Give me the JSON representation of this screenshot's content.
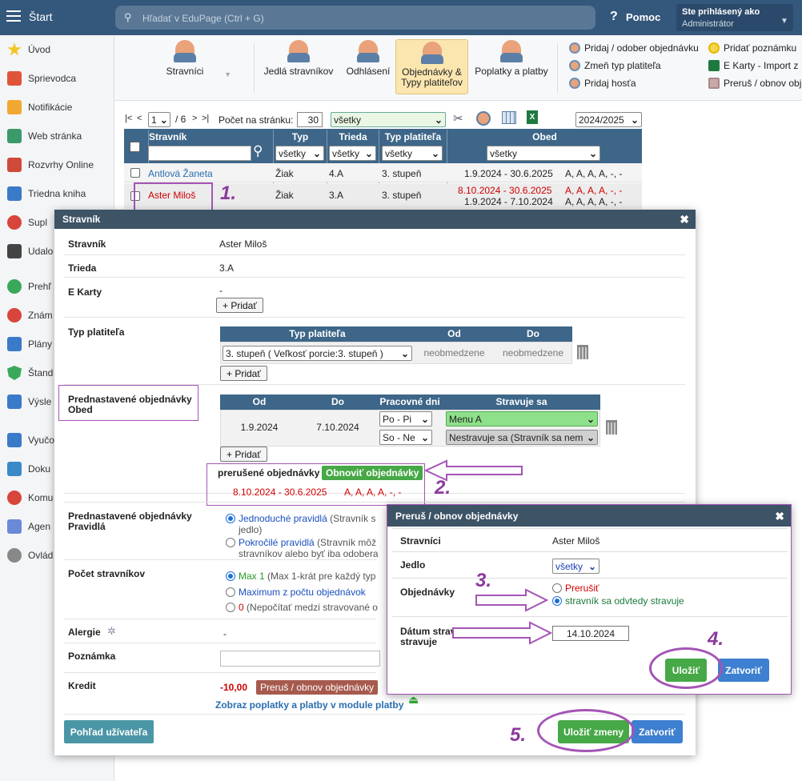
{
  "topbar": {
    "start": "Štart",
    "search_placeholder": "Hľadať v EduPage (Ctrl + G)",
    "help": "Pomoc",
    "logged_label": "Ste prihlásený ako",
    "logged_user": "Administrátor"
  },
  "sidebar": {
    "items": [
      "Úvod",
      "Sprievodca",
      "Notifikácie",
      "Web stránka",
      "Rozvrhy Online",
      "Triedna kniha",
      "Supl",
      "Udalo",
      "Prehľ",
      "Znám",
      "Plány",
      "Štand",
      "Výsle",
      "Vyučo",
      "Doku",
      "Komu",
      "Agen",
      "Ovlád"
    ]
  },
  "toolbar": {
    "stravnici": "Stravníci",
    "jedla": "Jedlá stravníkov",
    "odhlasenie": "Odhlásení",
    "objednavky": "Objednávky & Typy platiteľov",
    "poplatky": "Poplatky a platby",
    "links": [
      "Pridaj / odober objednávku",
      "Zmeň typ platiteľa",
      "Pridaj hosťa",
      "Pridať poznámku",
      "E Karty - Import z",
      "Preruš / obnov obj"
    ]
  },
  "pager": {
    "first": "|<",
    "prev": "<",
    "page": "1",
    "total": "/ 6",
    "next": ">",
    "last": ">|",
    "per_page_label": "Počet na stránku:",
    "per_page": "30",
    "filter": "všetky",
    "year": "2024/2025"
  },
  "table": {
    "headers": [
      "Stravník",
      "Typ",
      "Trieda",
      "Typ platiteľa",
      "Obed"
    ],
    "filter_all": "všetky",
    "rows": [
      {
        "name": "Antlová Žaneta",
        "typ": "Žiak",
        "trieda": "4.A",
        "platitel": "3. stupeň",
        "dates": [
          "1.9.2024 - 30.6.2025"
        ],
        "menu": [
          "A, A, A, A, -, -"
        ]
      },
      {
        "name": "Aster Miloš",
        "typ": "Žiak",
        "trieda": "3.A",
        "platitel": "3. stupeň",
        "dates": [
          "8.10.2024 - 30.6.2025",
          "1.9.2024 - 7.10.2024"
        ],
        "menu": [
          "A, A, A, A, -, -",
          "A, A, A, A, -, -"
        ]
      }
    ]
  },
  "dialog": {
    "title": "Stravník",
    "stravnik_label": "Stravník",
    "stravnik_value": "Aster Miloš",
    "trieda_label": "Trieda",
    "trieda_value": "3.A",
    "ekarty_label": "E Karty",
    "ekarty_value": "-",
    "add": "+ Pridať",
    "typ_label": "Typ platiteľa",
    "typ_headers": [
      "Typ platiteľa",
      "Od",
      "Do"
    ],
    "typ_value": "3. stupeň ( Veľkosť porcie:3. stupeň )",
    "typ_od": "neobmedzene",
    "typ_do": "neobmedzene",
    "pred_label": "Prednastavené objednávky Obed",
    "pred_headers": [
      "Od",
      "Do",
      "Pracovné dni",
      "Stravuje sa"
    ],
    "pred_od": "1.9.2024",
    "pred_do": "7.10.2024",
    "pred_days": [
      "Po - Pi",
      "So - Ne"
    ],
    "pred_menu": [
      "Menu A",
      "Nestravuje sa (Stravník sa nem"
    ],
    "prerusene": "prerušené objednávky",
    "obnovit": "Obnoviť objednávky",
    "prerusene_dates": "8.10.2024 - 30.6.2025",
    "prerusene_menu": "A, A, A, A, -, -",
    "pravidla_label": "Prednastavené objednávky Pravidlá",
    "pravidla_1_link": "Jednoduché pravidlá",
    "pravidla_1_text": "(Stravník s",
    "pravidla_1_text2": "jedlo)",
    "pravidla_2_link": "Pokročilé pravidlá",
    "pravidla_2_text": "(Stravník môž",
    "pravidla_2_text2": "stravníkov alebo byť iba odobera",
    "pocet_label": "Počet stravníkov",
    "pocet_1_link": "Max 1",
    "pocet_1_text": "(Max 1-krát pre každý typ",
    "pocet_2_link": "Maximum z počtu objednávok",
    "pocet_3_link": "0",
    "pocet_3_text": "(Nepočítať medzi stravované o",
    "alergie_label": "Alergie",
    "alergie_value": "-",
    "poznamka_label": "Poznámka",
    "kredit_label": "Kredit",
    "kredit_value": "-10,00",
    "prerus_btn": "Preruš / obnov objednávky",
    "poplatky_link": "Zobraz poplatky a platby v module platby",
    "pohlad": "Pohľad užívateľa",
    "ulozit": "Uložiť zmeny",
    "zatvorit": "Zatvoriť"
  },
  "dialog2": {
    "title": "Preruš / obnov objednávky",
    "stravnici_label": "Stravníci",
    "stravnici_value": "Aster Miloš",
    "jedlo_label": "Jedlo",
    "jedlo_value": "všetky",
    "obj_label": "Objednávky",
    "opt1": "Prerušiť",
    "opt2": "stravník sa odvtedy stravuje",
    "datum_label": "Dátum stravník sa odvtedy stravuje",
    "datum_value": "14.10.2024",
    "ulozit": "Uložiť",
    "zatvorit": "Zatvoriť"
  },
  "annotations": [
    "1.",
    "2.",
    "3.",
    "4.",
    "5."
  ],
  "colors": {
    "topbar": "#34577c",
    "header": "#3d6688",
    "annotation": "#8b3a9c",
    "green": "#46a846"
  }
}
